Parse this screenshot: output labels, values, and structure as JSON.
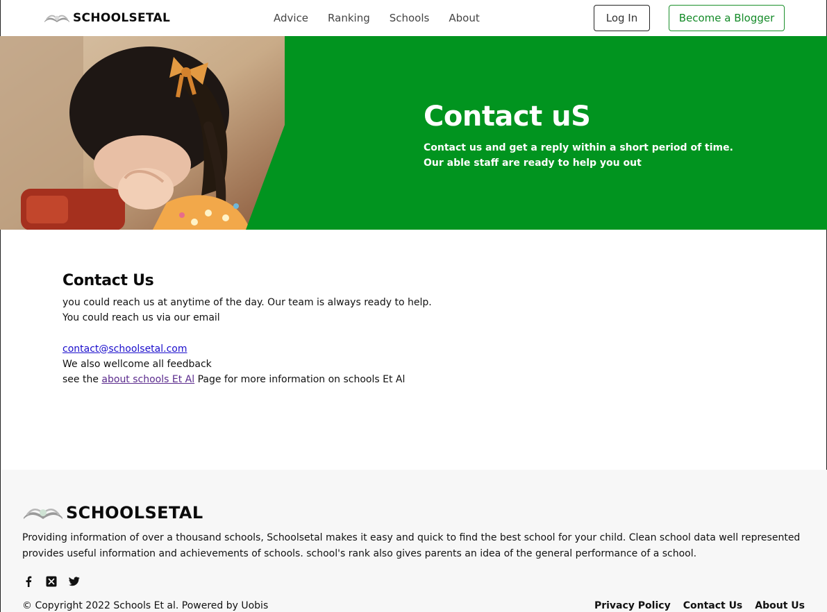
{
  "header": {
    "logo_text": "SCHOOLSETAL",
    "nav": [
      "Advice",
      "Ranking",
      "Schools",
      "About"
    ],
    "login_label": "Log In",
    "blogger_label": "Become a Blogger"
  },
  "hero": {
    "title": "Contact uS",
    "subtitle_line1": "Contact us and get a reply within a short period of time.",
    "subtitle_line2": "Our able staff are ready to help you out"
  },
  "contact": {
    "heading": "Contact Us",
    "line1": "you could reach us at anytime of the day. Our team is always ready to help.",
    "line2": "You could reach us via our email",
    "email": "contact@schoolsetal.com",
    "line3": "We also wellcome all feedback",
    "line4_prefix": "see the ",
    "line4_link": "about schools Et Al",
    "line4_suffix": " Page for more information on schools Et Al"
  },
  "footer": {
    "logo_text": "SCHOOLSETAL",
    "description": "Providing information of over a thousand schools, Schoolsetal makes it easy and quick to find the best school for your child. Clean school data well represented provides useful information and achievements of schools. school's rank also gives parents an idea of the general performance of a school.",
    "social": [
      "facebook-icon",
      "x-icon",
      "twitter-icon"
    ],
    "copyright": "© Copyright 2022 Schools Et al. Powered by Uobis",
    "links": [
      "Privacy Policy",
      "Contact Us",
      "About Us"
    ]
  },
  "colors": {
    "brand_green": "#01941f",
    "button_green": "#138a27",
    "email_link": "#1a0dcc",
    "visited_link": "#5a2a8c"
  }
}
